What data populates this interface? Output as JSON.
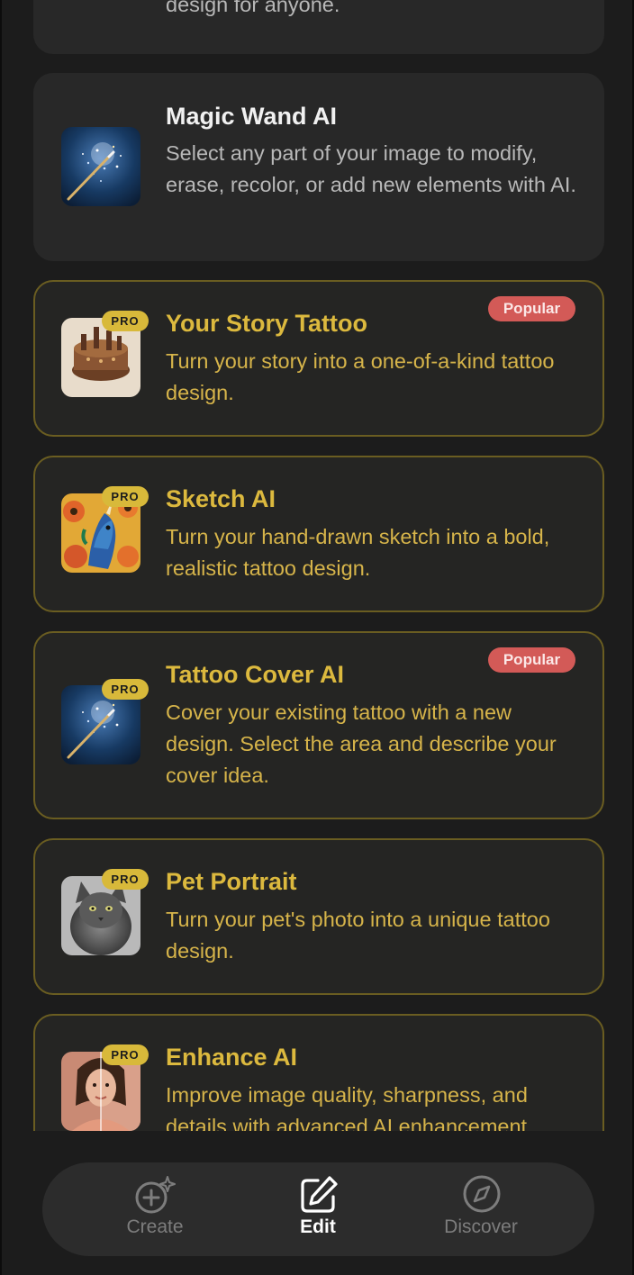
{
  "top_card": {
    "partial_desc": "design for anyone."
  },
  "cards": [
    {
      "title": "Magic Wand AI",
      "desc": "Select any part of your image to modify, erase, recolor, or add new elements with AI.",
      "icon": "magic-wand-image",
      "pro": false,
      "popular": false
    },
    {
      "title": "Your Story Tattoo",
      "desc": "Turn your story into a one-of-a-kind tattoo design.",
      "icon": "story-tattoo-image",
      "pro": true,
      "pro_label": "PRO",
      "popular": true,
      "popular_label": "Popular"
    },
    {
      "title": "Sketch AI",
      "desc": "Turn your hand-drawn sketch into a bold, realistic tattoo design.",
      "icon": "unicorn-sketch-image",
      "pro": true,
      "pro_label": "PRO",
      "popular": false
    },
    {
      "title": "Tattoo Cover AI",
      "desc": "Cover your existing tattoo with a new design. Select the area and describe your cover idea.",
      "icon": "magic-wand-image",
      "pro": true,
      "pro_label": "PRO",
      "popular": true,
      "popular_label": "Popular"
    },
    {
      "title": "Pet Portrait",
      "desc": "Turn your pet's photo into a unique tattoo design.",
      "icon": "cat-portrait-image",
      "pro": true,
      "pro_label": "PRO",
      "popular": false
    },
    {
      "title": "Enhance AI",
      "desc": "Improve image quality, sharpness, and details with advanced AI enhancement.",
      "icon": "face-enhance-image",
      "pro": true,
      "pro_label": "PRO",
      "popular": false
    }
  ],
  "colors": {
    "background": "#1c1c1c",
    "card": "#282828",
    "pro_gold": "#dcb93e",
    "pro_border": "#6a5d21",
    "popular_red": "#d35a57"
  },
  "nav": {
    "items": [
      {
        "label": "Create",
        "icon": "sparkle-plus-icon",
        "active": false
      },
      {
        "label": "Edit",
        "icon": "edit-pencil-icon",
        "active": true
      },
      {
        "label": "Discover",
        "icon": "compass-icon",
        "active": false
      }
    ]
  }
}
